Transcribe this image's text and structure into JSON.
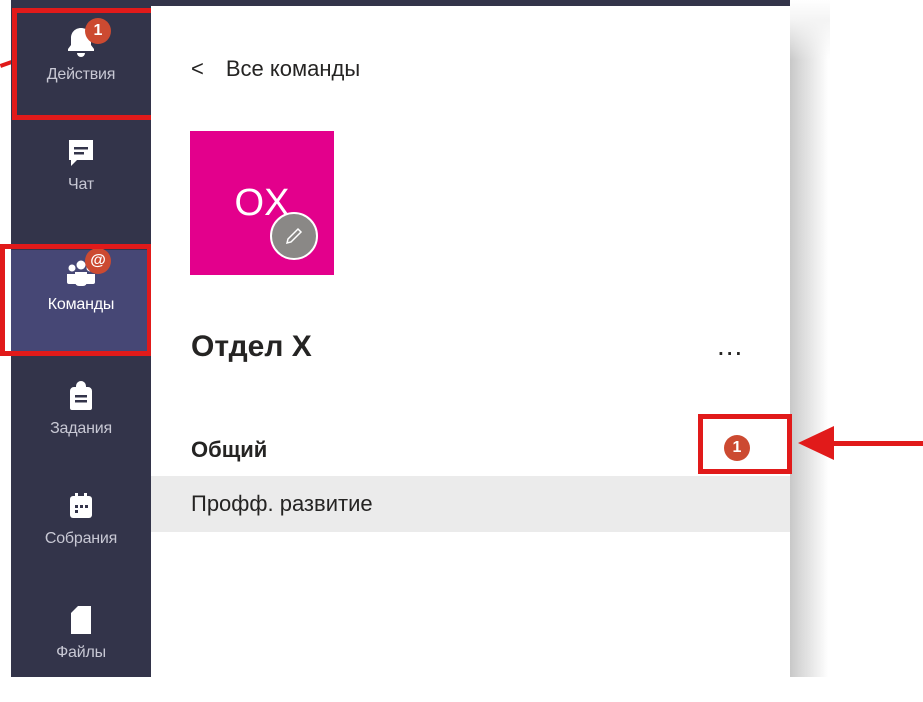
{
  "rail": {
    "items": [
      {
        "label": "Действия",
        "badge": "1"
      },
      {
        "label": "Чат"
      },
      {
        "label": "Команды",
        "badge": "@"
      },
      {
        "label": "Задания"
      },
      {
        "label": "Собрания"
      },
      {
        "label": "Файлы"
      }
    ]
  },
  "panel": {
    "back_label": "Все команды",
    "back_chevron": "<",
    "team_initials": "OX",
    "team_name": "Отдел X",
    "more_label": "...",
    "channels": [
      {
        "label": "Общий",
        "unread": "1"
      },
      {
        "label": "Профф. развитие"
      }
    ]
  },
  "colors": {
    "rail": "#33344a",
    "rail_active": "#464775",
    "badge": "#cc4a31",
    "avatar": "#e3008c",
    "highlight": "#e11a1a"
  }
}
